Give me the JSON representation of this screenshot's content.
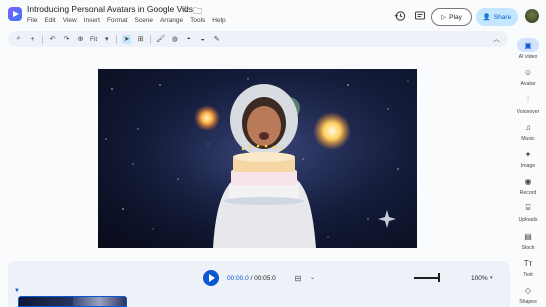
{
  "document": {
    "title": "Introducing Personal Avatars in Google Vids"
  },
  "menu": [
    "File",
    "Edit",
    "View",
    "Insert",
    "Format",
    "Scene",
    "Arrange",
    "Tools",
    "Help"
  ],
  "header": {
    "play_label": "Play",
    "share_label": "Share"
  },
  "toolbar": {
    "fit_label": "Fit"
  },
  "sidebar": {
    "items": [
      {
        "label": "AI video",
        "icon": "ai-video-icon"
      },
      {
        "label": "Avatar",
        "icon": "avatar-icon"
      },
      {
        "label": "Voiceover",
        "icon": "voiceover-icon"
      },
      {
        "label": "Music",
        "icon": "music-icon"
      },
      {
        "label": "Image",
        "icon": "image-icon"
      },
      {
        "label": "Record",
        "icon": "record-icon"
      },
      {
        "label": "Uploads",
        "icon": "uploads-icon"
      },
      {
        "label": "Stock",
        "icon": "stock-icon"
      },
      {
        "label": "Text",
        "icon": "text-icon"
      },
      {
        "label": "Shapes",
        "icon": "shapes-icon"
      }
    ]
  },
  "playback": {
    "current_time": "00:00.0",
    "separator": " / ",
    "duration": "00:05.0"
  },
  "zoom": {
    "level": "100%"
  },
  "colors": {
    "accent": "#0b57d0",
    "share_bg": "#c2e7ff",
    "active_nav": "#d3e3fd"
  }
}
